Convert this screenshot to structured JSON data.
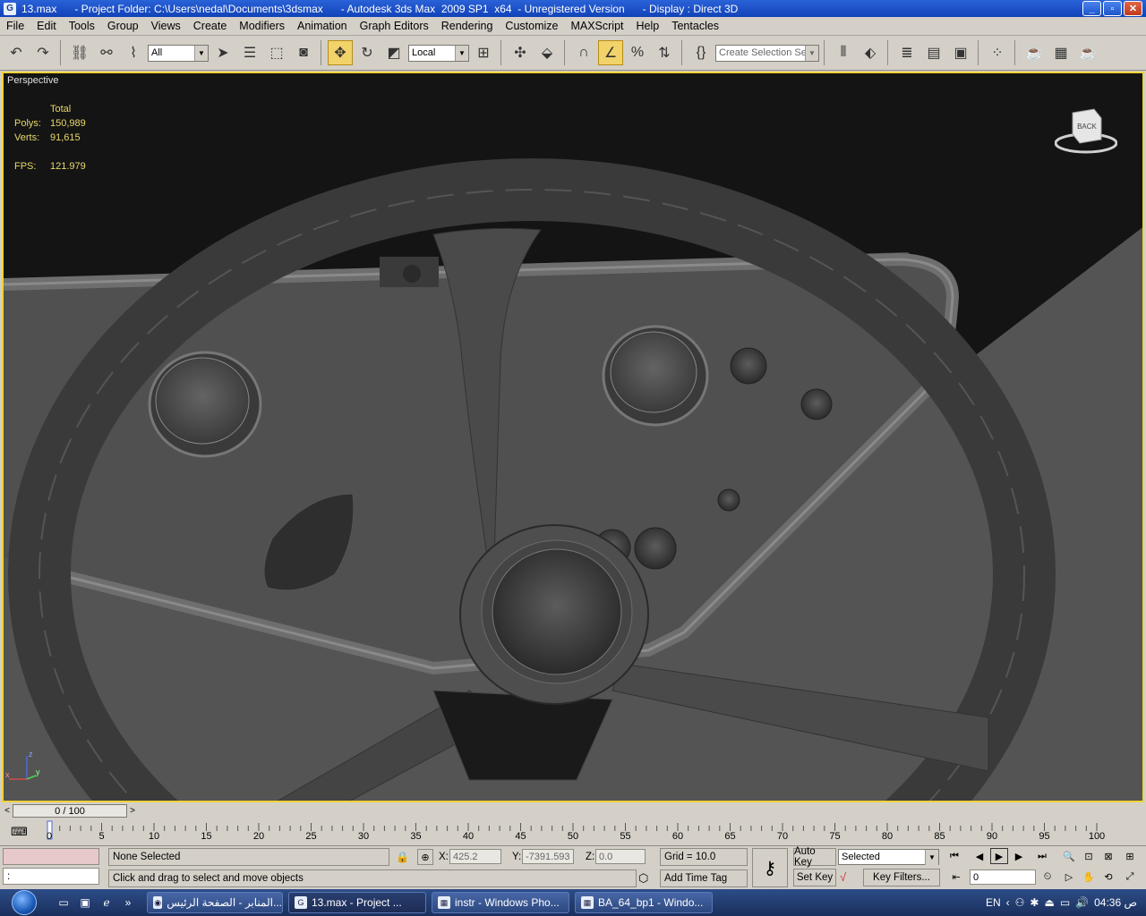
{
  "window": {
    "title": "13.max      - Project Folder: C:\\Users\\nedal\\Documents\\3dsmax      - Autodesk 3ds Max  2009 SP1  x64  - Unregistered Version      - Display : Direct 3D"
  },
  "menu": [
    "File",
    "Edit",
    "Tools",
    "Group",
    "Views",
    "Create",
    "Modifiers",
    "Animation",
    "Graph Editors",
    "Rendering",
    "Customize",
    "MAXScript",
    "Help",
    "Tentacles"
  ],
  "toolbar": {
    "selection_filter": "All",
    "reference_coord": "Local",
    "named_selection_placeholder": "Create Selection Set"
  },
  "viewport": {
    "label": "Perspective",
    "stats_header": "Total",
    "polys_label": "Polys:",
    "polys_value": "150,989",
    "verts_label": "Verts:",
    "verts_value": "91,615",
    "fps_label": "FPS:",
    "fps_value": "121.979",
    "viewcube_face": "BACK",
    "axis_z": "z",
    "axis_x": "x",
    "axis_y": "y"
  },
  "timeslider": {
    "frame_display": "0 / 100",
    "ticks": [
      "0",
      "5",
      "10",
      "15",
      "20",
      "25",
      "30",
      "35",
      "40",
      "45",
      "50",
      "55",
      "60",
      "65",
      "70",
      "75",
      "80",
      "85",
      "90",
      "95",
      "100"
    ]
  },
  "status": {
    "maxscript_prompt": ":",
    "selection_status": "None Selected",
    "prompt_line": "Click and drag to select and move objects",
    "x_label": "X:",
    "x_value": "425.2",
    "y_label": "Y:",
    "y_value": "-7391.593",
    "z_label": "Z:",
    "z_value": "0.0",
    "grid": "Grid = 10.0",
    "add_time_tag": "Add Time Tag",
    "auto_key": "Auto Key",
    "set_key": "Set Key",
    "key_mode_select": "Selected",
    "key_filters": "Key Filters...",
    "current_frame": "0"
  },
  "taskbar": {
    "tasks": [
      "المنابر - الصفحة الرئيس...",
      "13.max      - Project ...",
      "instr - Windows Pho...",
      "BA_64_bp1 - Windo..."
    ],
    "language": "EN",
    "clock": "04:36 ص"
  },
  "colors": {
    "viewport_border": "#f0d23a",
    "stats_text": "#e8d86a",
    "title_bar": "#1a4fc8"
  }
}
